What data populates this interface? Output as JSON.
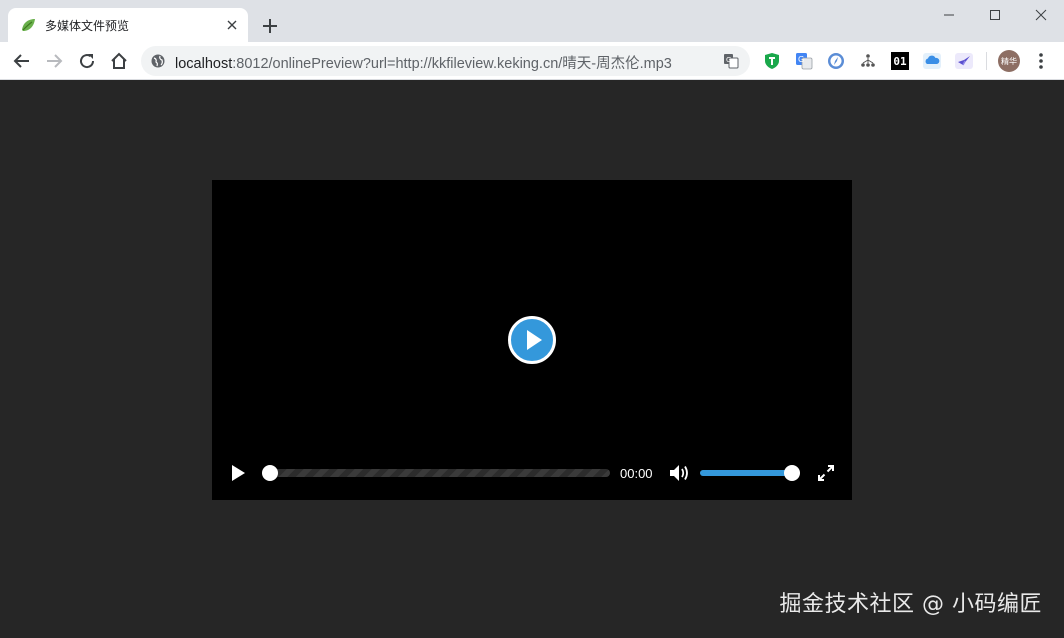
{
  "tab": {
    "title": "多媒体文件预览"
  },
  "address": {
    "host": "localhost",
    "rest": ":8012/onlinePreview?url=http://kkfileview.keking.cn/晴天-周杰伦.mp3"
  },
  "profile": {
    "avatar_label": "精华"
  },
  "extensions": [
    "shield-extension",
    "translate-extension",
    "compass-extension",
    "sitemap-extension",
    "binary-extension",
    "cloud-extension",
    "flutter-extension"
  ],
  "extension_binary_label": "01",
  "player": {
    "current_time": "00:00",
    "progress": 0,
    "volume": 1.0,
    "accent_color": "#3498db"
  },
  "watermark": "掘金技术社区 @ 小码编匠"
}
